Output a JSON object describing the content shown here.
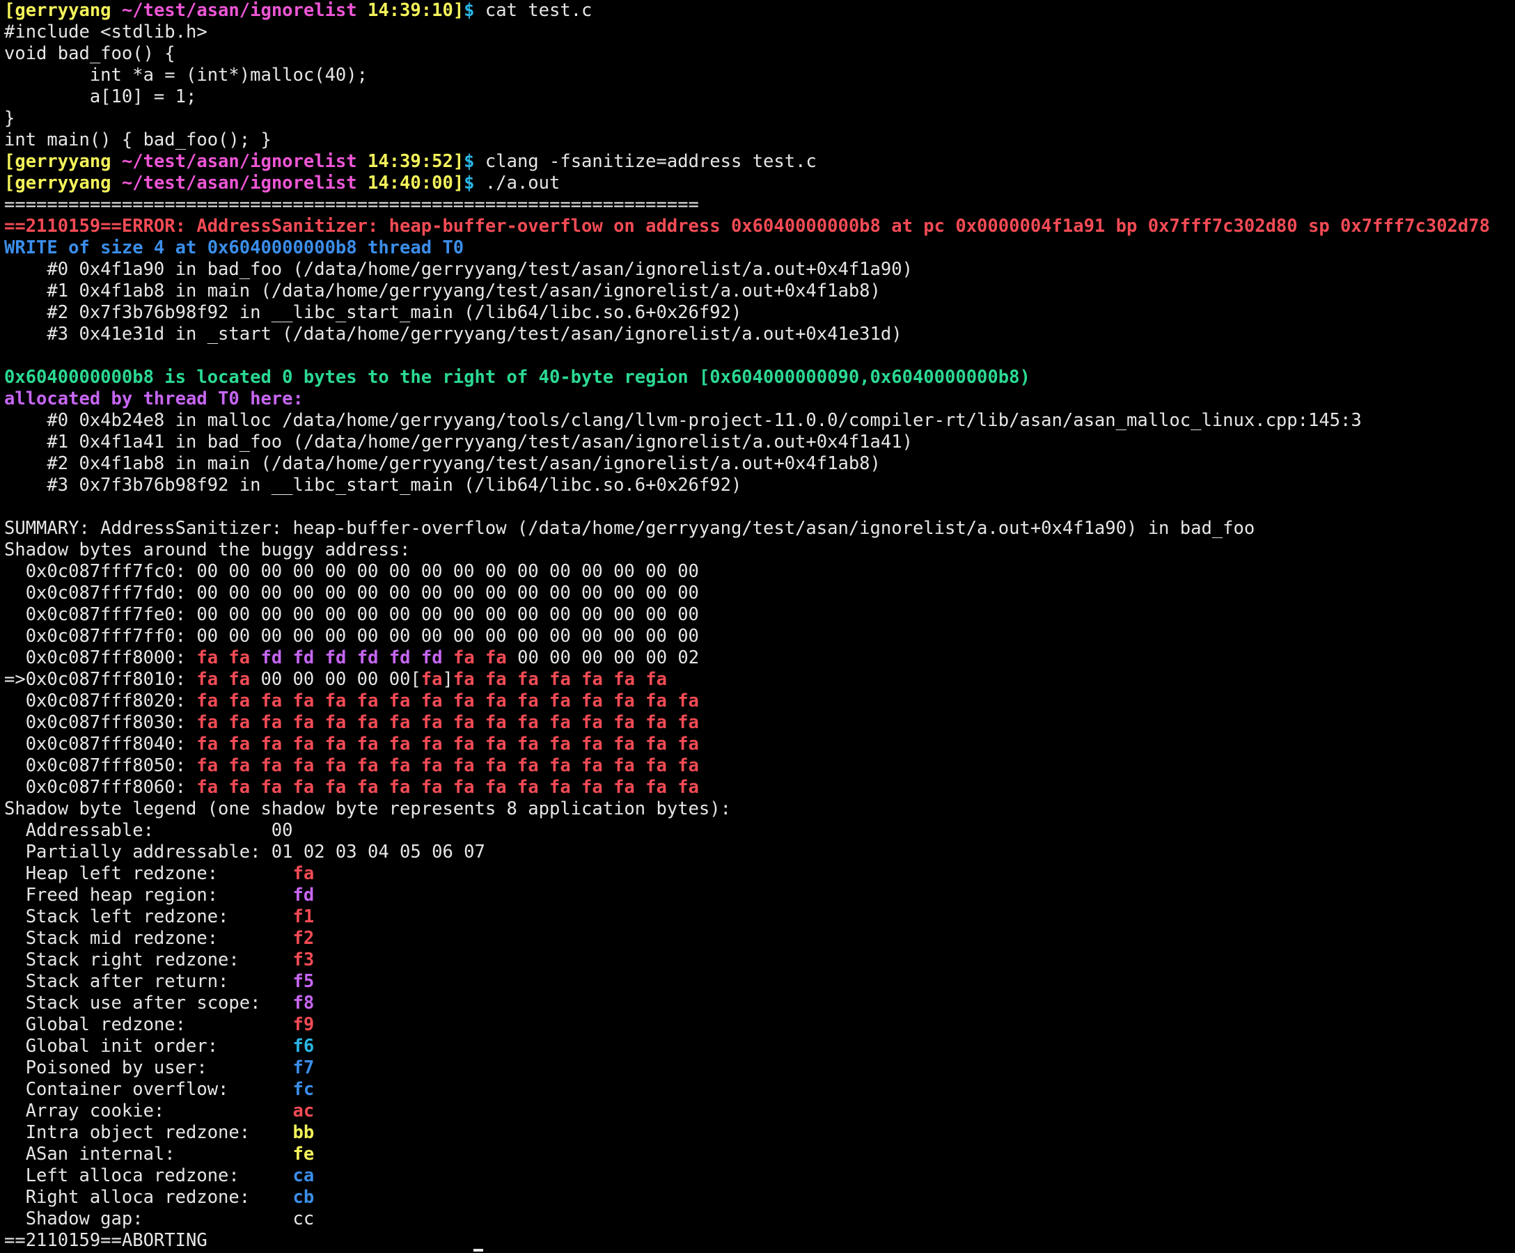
{
  "lines": [
    [
      {
        "t": "[",
        "c": "yellow",
        "b": 1
      },
      {
        "t": "gerryyang",
        "c": "yellow",
        "b": 1
      },
      {
        "t": " ~/test/asan/ignorelist",
        "c": "magenta",
        "b": 1
      },
      {
        "t": " 14:39:10",
        "c": "yellow",
        "b": 1
      },
      {
        "t": "]",
        "c": "yellow",
        "b": 1
      },
      {
        "t": "$ ",
        "c": "cyan",
        "b": 1
      },
      {
        "t": "cat test.c",
        "c": "white"
      }
    ],
    [
      {
        "t": "#include <stdlib.h>"
      }
    ],
    [
      {
        "t": "void bad_foo() {"
      }
    ],
    [
      {
        "t": "        int *a = (int*)malloc(40);"
      }
    ],
    [
      {
        "t": "        a[10] = 1;"
      }
    ],
    [
      {
        "t": "}"
      }
    ],
    [
      {
        "t": "int main() { bad_foo(); }"
      }
    ],
    [
      {
        "t": "[",
        "c": "yellow",
        "b": 1
      },
      {
        "t": "gerryyang",
        "c": "yellow",
        "b": 1
      },
      {
        "t": " ~/test/asan/ignorelist",
        "c": "magenta",
        "b": 1
      },
      {
        "t": " 14:39:52",
        "c": "yellow",
        "b": 1
      },
      {
        "t": "]",
        "c": "yellow",
        "b": 1
      },
      {
        "t": "$ ",
        "c": "cyan",
        "b": 1
      },
      {
        "t": "clang -fsanitize=address test.c",
        "c": "white"
      }
    ],
    [
      {
        "t": "[",
        "c": "yellow",
        "b": 1
      },
      {
        "t": "gerryyang",
        "c": "yellow",
        "b": 1
      },
      {
        "t": " ~/test/asan/ignorelist",
        "c": "magenta",
        "b": 1
      },
      {
        "t": " 14:40:00",
        "c": "yellow",
        "b": 1
      },
      {
        "t": "]",
        "c": "yellow",
        "b": 1
      },
      {
        "t": "$ ",
        "c": "cyan",
        "b": 1
      },
      {
        "t": "./a.out",
        "c": "white"
      }
    ],
    [
      {
        "t": "================================================================="
      }
    ],
    [
      {
        "t": "==2110159==ERROR: AddressSanitizer: heap-buffer-overflow on address 0x6040000000b8 at pc 0x0000004f1a91 bp 0x7fff7c302d80 sp 0x7fff7c302d78",
        "c": "red",
        "b": 1
      }
    ],
    [
      {
        "t": "WRITE of size 4 at 0x6040000000b8 thread T0",
        "c": "blue",
        "b": 1
      }
    ],
    [
      {
        "t": "    #0 0x4f1a90 in bad_foo (/data/home/gerryyang/test/asan/ignorelist/a.out+0x4f1a90)"
      }
    ],
    [
      {
        "t": "    #1 0x4f1ab8 in main (/data/home/gerryyang/test/asan/ignorelist/a.out+0x4f1ab8)"
      }
    ],
    [
      {
        "t": "    #2 0x7f3b76b98f92 in __libc_start_main (/lib64/libc.so.6+0x26f92)"
      }
    ],
    [
      {
        "t": "    #3 0x41e31d in _start (/data/home/gerryyang/test/asan/ignorelist/a.out+0x41e31d)"
      }
    ],
    [
      {
        "t": ""
      }
    ],
    [
      {
        "t": "0x6040000000b8 is located 0 bytes to the right of 40-byte region [0x604000000090,0x6040000000b8)",
        "c": "green",
        "b": 1
      }
    ],
    [
      {
        "t": "allocated by thread T0 here:",
        "c": "violet",
        "b": 1
      }
    ],
    [
      {
        "t": "    #0 0x4b24e8 in malloc /data/home/gerryyang/tools/clang/llvm-project-11.0.0/compiler-rt/lib/asan/asan_malloc_linux.cpp:145:3"
      }
    ],
    [
      {
        "t": "    #1 0x4f1a41 in bad_foo (/data/home/gerryyang/test/asan/ignorelist/a.out+0x4f1a41)"
      }
    ],
    [
      {
        "t": "    #2 0x4f1ab8 in main (/data/home/gerryyang/test/asan/ignorelist/a.out+0x4f1ab8)"
      }
    ],
    [
      {
        "t": "    #3 0x7f3b76b98f92 in __libc_start_main (/lib64/libc.so.6+0x26f92)"
      }
    ],
    [
      {
        "t": ""
      }
    ],
    [
      {
        "t": "SUMMARY: AddressSanitizer: heap-buffer-overflow (/data/home/gerryyang/test/asan/ignorelist/a.out+0x4f1a90) in bad_foo"
      }
    ],
    [
      {
        "t": "Shadow bytes around the buggy address:"
      }
    ],
    [
      {
        "t": "  0x0c087fff7fc0: 00 00 00 00 00 00 00 00 00 00 00 00 00 00 00 00"
      }
    ],
    [
      {
        "t": "  0x0c087fff7fd0: 00 00 00 00 00 00 00 00 00 00 00 00 00 00 00 00"
      }
    ],
    [
      {
        "t": "  0x0c087fff7fe0: 00 00 00 00 00 00 00 00 00 00 00 00 00 00 00 00"
      }
    ],
    [
      {
        "t": "  0x0c087fff7ff0: 00 00 00 00 00 00 00 00 00 00 00 00 00 00 00 00"
      }
    ],
    [
      {
        "t": "  0x0c087fff8000: "
      },
      {
        "t": "fa",
        "c": "red",
        "b": 1
      },
      {
        "t": " "
      },
      {
        "t": "fa",
        "c": "red",
        "b": 1
      },
      {
        "t": " "
      },
      {
        "t": "fd",
        "c": "violet",
        "b": 1
      },
      {
        "t": " "
      },
      {
        "t": "fd",
        "c": "violet",
        "b": 1
      },
      {
        "t": " "
      },
      {
        "t": "fd",
        "c": "violet",
        "b": 1
      },
      {
        "t": " "
      },
      {
        "t": "fd",
        "c": "violet",
        "b": 1
      },
      {
        "t": " "
      },
      {
        "t": "fd",
        "c": "violet",
        "b": 1
      },
      {
        "t": " "
      },
      {
        "t": "fd",
        "c": "violet",
        "b": 1
      },
      {
        "t": " "
      },
      {
        "t": "fa",
        "c": "red",
        "b": 1
      },
      {
        "t": " "
      },
      {
        "t": "fa",
        "c": "red",
        "b": 1
      },
      {
        "t": " 00 00 00 00 00 02"
      }
    ],
    [
      {
        "t": "=>0x0c087fff8010: "
      },
      {
        "t": "fa",
        "c": "red",
        "b": 1
      },
      {
        "t": " "
      },
      {
        "t": "fa",
        "c": "red",
        "b": 1
      },
      {
        "t": " 00 00 00 00 00["
      },
      {
        "t": "fa",
        "c": "red",
        "b": 1
      },
      {
        "t": "]"
      },
      {
        "t": "fa",
        "c": "red",
        "b": 1
      },
      {
        "t": " "
      },
      {
        "t": "fa",
        "c": "red",
        "b": 1
      },
      {
        "t": " "
      },
      {
        "t": "fa",
        "c": "red",
        "b": 1
      },
      {
        "t": " "
      },
      {
        "t": "fa",
        "c": "red",
        "b": 1
      },
      {
        "t": " "
      },
      {
        "t": "fa",
        "c": "red",
        "b": 1
      },
      {
        "t": " "
      },
      {
        "t": "fa",
        "c": "red",
        "b": 1
      },
      {
        "t": " "
      },
      {
        "t": "fa",
        "c": "red",
        "b": 1
      }
    ],
    [
      {
        "t": "  0x0c087fff8020: "
      },
      {
        "t": "fa fa fa fa fa fa fa fa fa fa fa fa fa fa fa fa",
        "c": "red",
        "b": 1
      }
    ],
    [
      {
        "t": "  0x0c087fff8030: "
      },
      {
        "t": "fa fa fa fa fa fa fa fa fa fa fa fa fa fa fa fa",
        "c": "red",
        "b": 1
      }
    ],
    [
      {
        "t": "  0x0c087fff8040: "
      },
      {
        "t": "fa fa fa fa fa fa fa fa fa fa fa fa fa fa fa fa",
        "c": "red",
        "b": 1
      }
    ],
    [
      {
        "t": "  0x0c087fff8050: "
      },
      {
        "t": "fa fa fa fa fa fa fa fa fa fa fa fa fa fa fa fa",
        "c": "red",
        "b": 1
      }
    ],
    [
      {
        "t": "  0x0c087fff8060: "
      },
      {
        "t": "fa fa fa fa fa fa fa fa fa fa fa fa fa fa fa fa",
        "c": "red",
        "b": 1
      }
    ],
    [
      {
        "t": "Shadow byte legend (one shadow byte represents 8 application bytes):"
      }
    ],
    [
      {
        "t": "  Addressable:           00"
      }
    ],
    [
      {
        "t": "  Partially addressable: 01 02 03 04 05 06 07"
      }
    ],
    [
      {
        "t": "  Heap left redzone:       "
      },
      {
        "t": "fa",
        "c": "red",
        "b": 1
      }
    ],
    [
      {
        "t": "  Freed heap region:       "
      },
      {
        "t": "fd",
        "c": "violet",
        "b": 1
      }
    ],
    [
      {
        "t": "  Stack left redzone:      "
      },
      {
        "t": "f1",
        "c": "red",
        "b": 1
      }
    ],
    [
      {
        "t": "  Stack mid redzone:       "
      },
      {
        "t": "f2",
        "c": "red",
        "b": 1
      }
    ],
    [
      {
        "t": "  Stack right redzone:     "
      },
      {
        "t": "f3",
        "c": "red",
        "b": 1
      }
    ],
    [
      {
        "t": "  Stack after return:      "
      },
      {
        "t": "f5",
        "c": "violet",
        "b": 1
      }
    ],
    [
      {
        "t": "  Stack use after scope:   "
      },
      {
        "t": "f8",
        "c": "violet",
        "b": 1
      }
    ],
    [
      {
        "t": "  Global redzone:          "
      },
      {
        "t": "f9",
        "c": "red",
        "b": 1
      }
    ],
    [
      {
        "t": "  Global init order:       "
      },
      {
        "t": "f6",
        "c": "cyan",
        "b": 1
      }
    ],
    [
      {
        "t": "  Poisoned by user:        "
      },
      {
        "t": "f7",
        "c": "blue",
        "b": 1
      }
    ],
    [
      {
        "t": "  Container overflow:      "
      },
      {
        "t": "fc",
        "c": "blue",
        "b": 1
      }
    ],
    [
      {
        "t": "  Array cookie:            "
      },
      {
        "t": "ac",
        "c": "red",
        "b": 1
      }
    ],
    [
      {
        "t": "  Intra object redzone:    "
      },
      {
        "t": "bb",
        "c": "yellow",
        "b": 1
      }
    ],
    [
      {
        "t": "  ASan internal:           "
      },
      {
        "t": "fe",
        "c": "yellow",
        "b": 1
      }
    ],
    [
      {
        "t": "  Left alloca redzone:     "
      },
      {
        "t": "ca",
        "c": "blue",
        "b": 1
      }
    ],
    [
      {
        "t": "  Right alloca redzone:    "
      },
      {
        "t": "cb",
        "c": "blue",
        "b": 1
      }
    ],
    [
      {
        "t": "  Shadow gap:              cc"
      }
    ],
    [
      {
        "t": "==2110159==ABORTING"
      }
    ]
  ],
  "colors": {
    "background": "#000000",
    "foreground": "#e6e6e6",
    "yellow": "#f3f35a",
    "magenta": "#ee56d6",
    "red": "#f34b55",
    "blue": "#3b8eea",
    "green": "#2bd992",
    "violet": "#c766f3",
    "cyan": "#2ab7e6"
  }
}
